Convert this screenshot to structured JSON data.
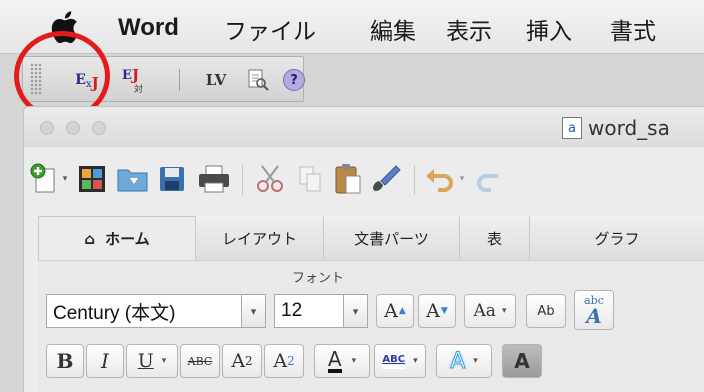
{
  "menubar": {
    "app_name": "Word",
    "items": [
      "ファイル",
      "編集",
      "表示",
      "挿入",
      "書式"
    ]
  },
  "palette": {
    "lv_label": "LV",
    "help_label": "?",
    "ex_label_e": "E",
    "ex_label_x": "x",
    "ex_label_j": "J",
    "ex2_label_sub": "対"
  },
  "window": {
    "title": "word_sa",
    "doc_icon_letter": "a"
  },
  "ribbon": {
    "tabs": [
      "ホーム",
      "レイアウト",
      "文書パーツ",
      "表",
      "グラフ"
    ],
    "group_label": "フォント",
    "font_name": "Century (本文)",
    "font_size": "12",
    "grow_label": "A",
    "shrink_label": "A",
    "bold_label": "B",
    "italic_label": "I",
    "underline_label": "U",
    "strike_label": "ABC",
    "superscript_base": "A",
    "superscript_exp": "2",
    "subscript_base": "A",
    "subscript_exp": "2",
    "font_color_label": "A",
    "highlight_label": "ABC",
    "text_effect_label": "A",
    "change_case_label": "Aa",
    "clear_format_label": "Ab",
    "phonetic_top": "abc",
    "phonetic_main": "A"
  },
  "colors": {
    "annotation_circle": "#e31b1b",
    "accent_blue": "#2a55b0",
    "accent_red": "#d81b1b"
  }
}
